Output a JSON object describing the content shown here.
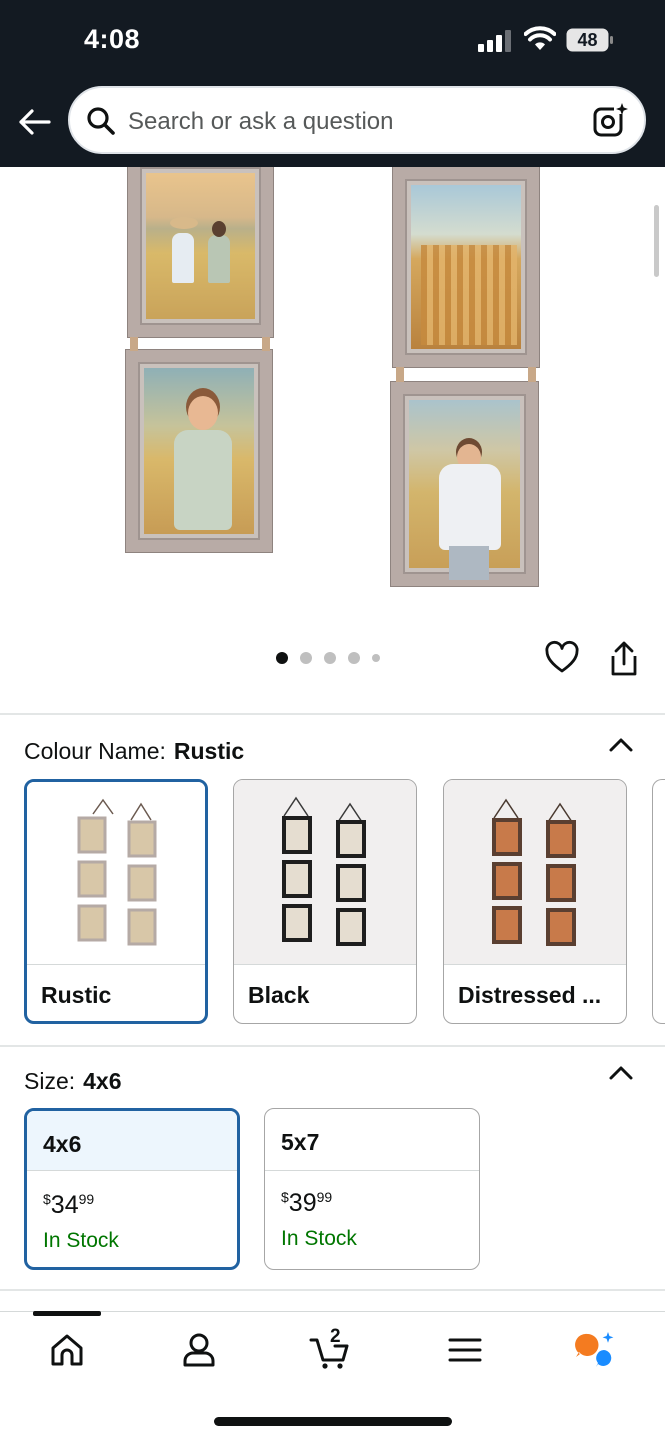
{
  "status_bar": {
    "time": "4:08",
    "battery_level": "48"
  },
  "search": {
    "placeholder": "Search or ask a question"
  },
  "gallery": {
    "image_count": 5,
    "active_index": 0
  },
  "colour": {
    "label": "Colour Name:",
    "selected": "Rustic",
    "options": [
      {
        "label": "Rustic",
        "frame_color": "#b5aaa5"
      },
      {
        "label": "Black",
        "frame_color": "#1e1e1e"
      },
      {
        "label": "Distressed ...",
        "frame_color": "#5a3f31"
      }
    ]
  },
  "size": {
    "label": "Size:",
    "selected": "4x6",
    "options": [
      {
        "label": "4x6",
        "currency": "$",
        "price_main": "34",
        "price_cents": "99",
        "stock": "In Stock"
      },
      {
        "label": "5x7",
        "currency": "$",
        "price_main": "39",
        "price_cents": "99",
        "stock": "In Stock"
      }
    ]
  },
  "bottom_nav": {
    "items": [
      "home-icon",
      "account-icon",
      "cart-icon",
      "menu-icon",
      "rufus-icon"
    ],
    "cart_count": "2"
  },
  "colors": {
    "header_bg": "#131a22",
    "selected_border": "#2162a1",
    "in_stock": "#007600",
    "accent_orange": "#f47b20",
    "accent_blue": "#1a8cff"
  }
}
